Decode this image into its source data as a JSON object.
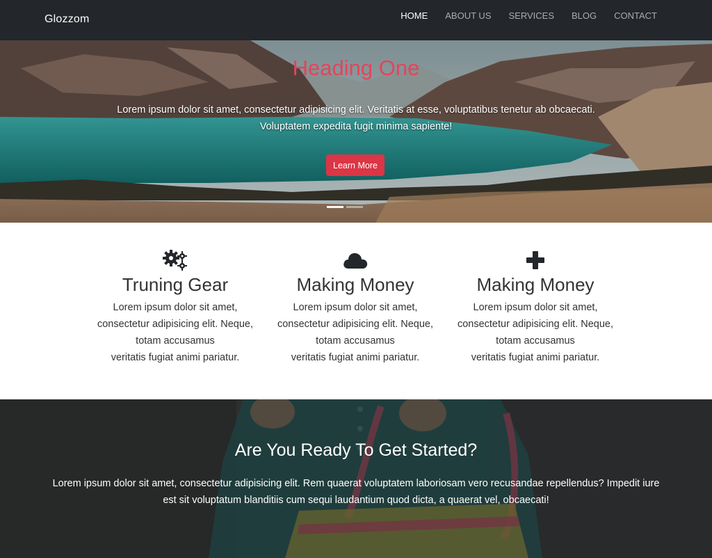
{
  "navbar": {
    "brand": "Glozzom",
    "links": [
      {
        "label": "HOME",
        "active": true
      },
      {
        "label": "ABOUT US",
        "active": false
      },
      {
        "label": "SERVICES",
        "active": false
      },
      {
        "label": "BLOG",
        "active": false
      },
      {
        "label": "CONTACT",
        "active": false
      }
    ]
  },
  "hero": {
    "title": "Heading One",
    "text": "Lorem ipsum dolor sit amet, consectetur adipisicing elit. Veritatis at esse, voluptatibus tenetur ab obcaecati. Voluptatem expedita fugit minima sapiente!",
    "button_label": "Learn More",
    "slides": 2,
    "active_slide": 1,
    "colors": {
      "title": "#e2455c",
      "button": "#dc3545"
    }
  },
  "features": [
    {
      "icon": "gears-icon",
      "title": "Truning Gear",
      "lines": [
        "Lorem ipsum dolor sit amet,",
        "consectetur adipisicing elit. Neque,",
        "totam accusamus",
        "veritatis fugiat animi pariatur."
      ]
    },
    {
      "icon": "cloud-icon",
      "title": "Making Money",
      "lines": [
        "Lorem ipsum dolor sit amet,",
        "consectetur adipisicing elit. Neque,",
        "totam accusamus",
        "veritatis fugiat animi pariatur."
      ]
    },
    {
      "icon": "plus-icon",
      "title": "Making Money",
      "lines": [
        "Lorem ipsum dolor sit amet,",
        "consectetur adipisicing elit. Neque,",
        "totam accusamus",
        "veritatis fugiat animi pariatur."
      ]
    }
  ],
  "cta": {
    "title": "Are You Ready To Get Started?",
    "text": "Lorem ipsum dolor sit amet, consectetur adipisicing elit. Rem quaerat voluptatem laboriosam vero recusandae repellendus? Impedit iure est sit voluptatum blanditiis cum sequi laudantium quod dicta, a quaerat vel, obcaecati!"
  }
}
